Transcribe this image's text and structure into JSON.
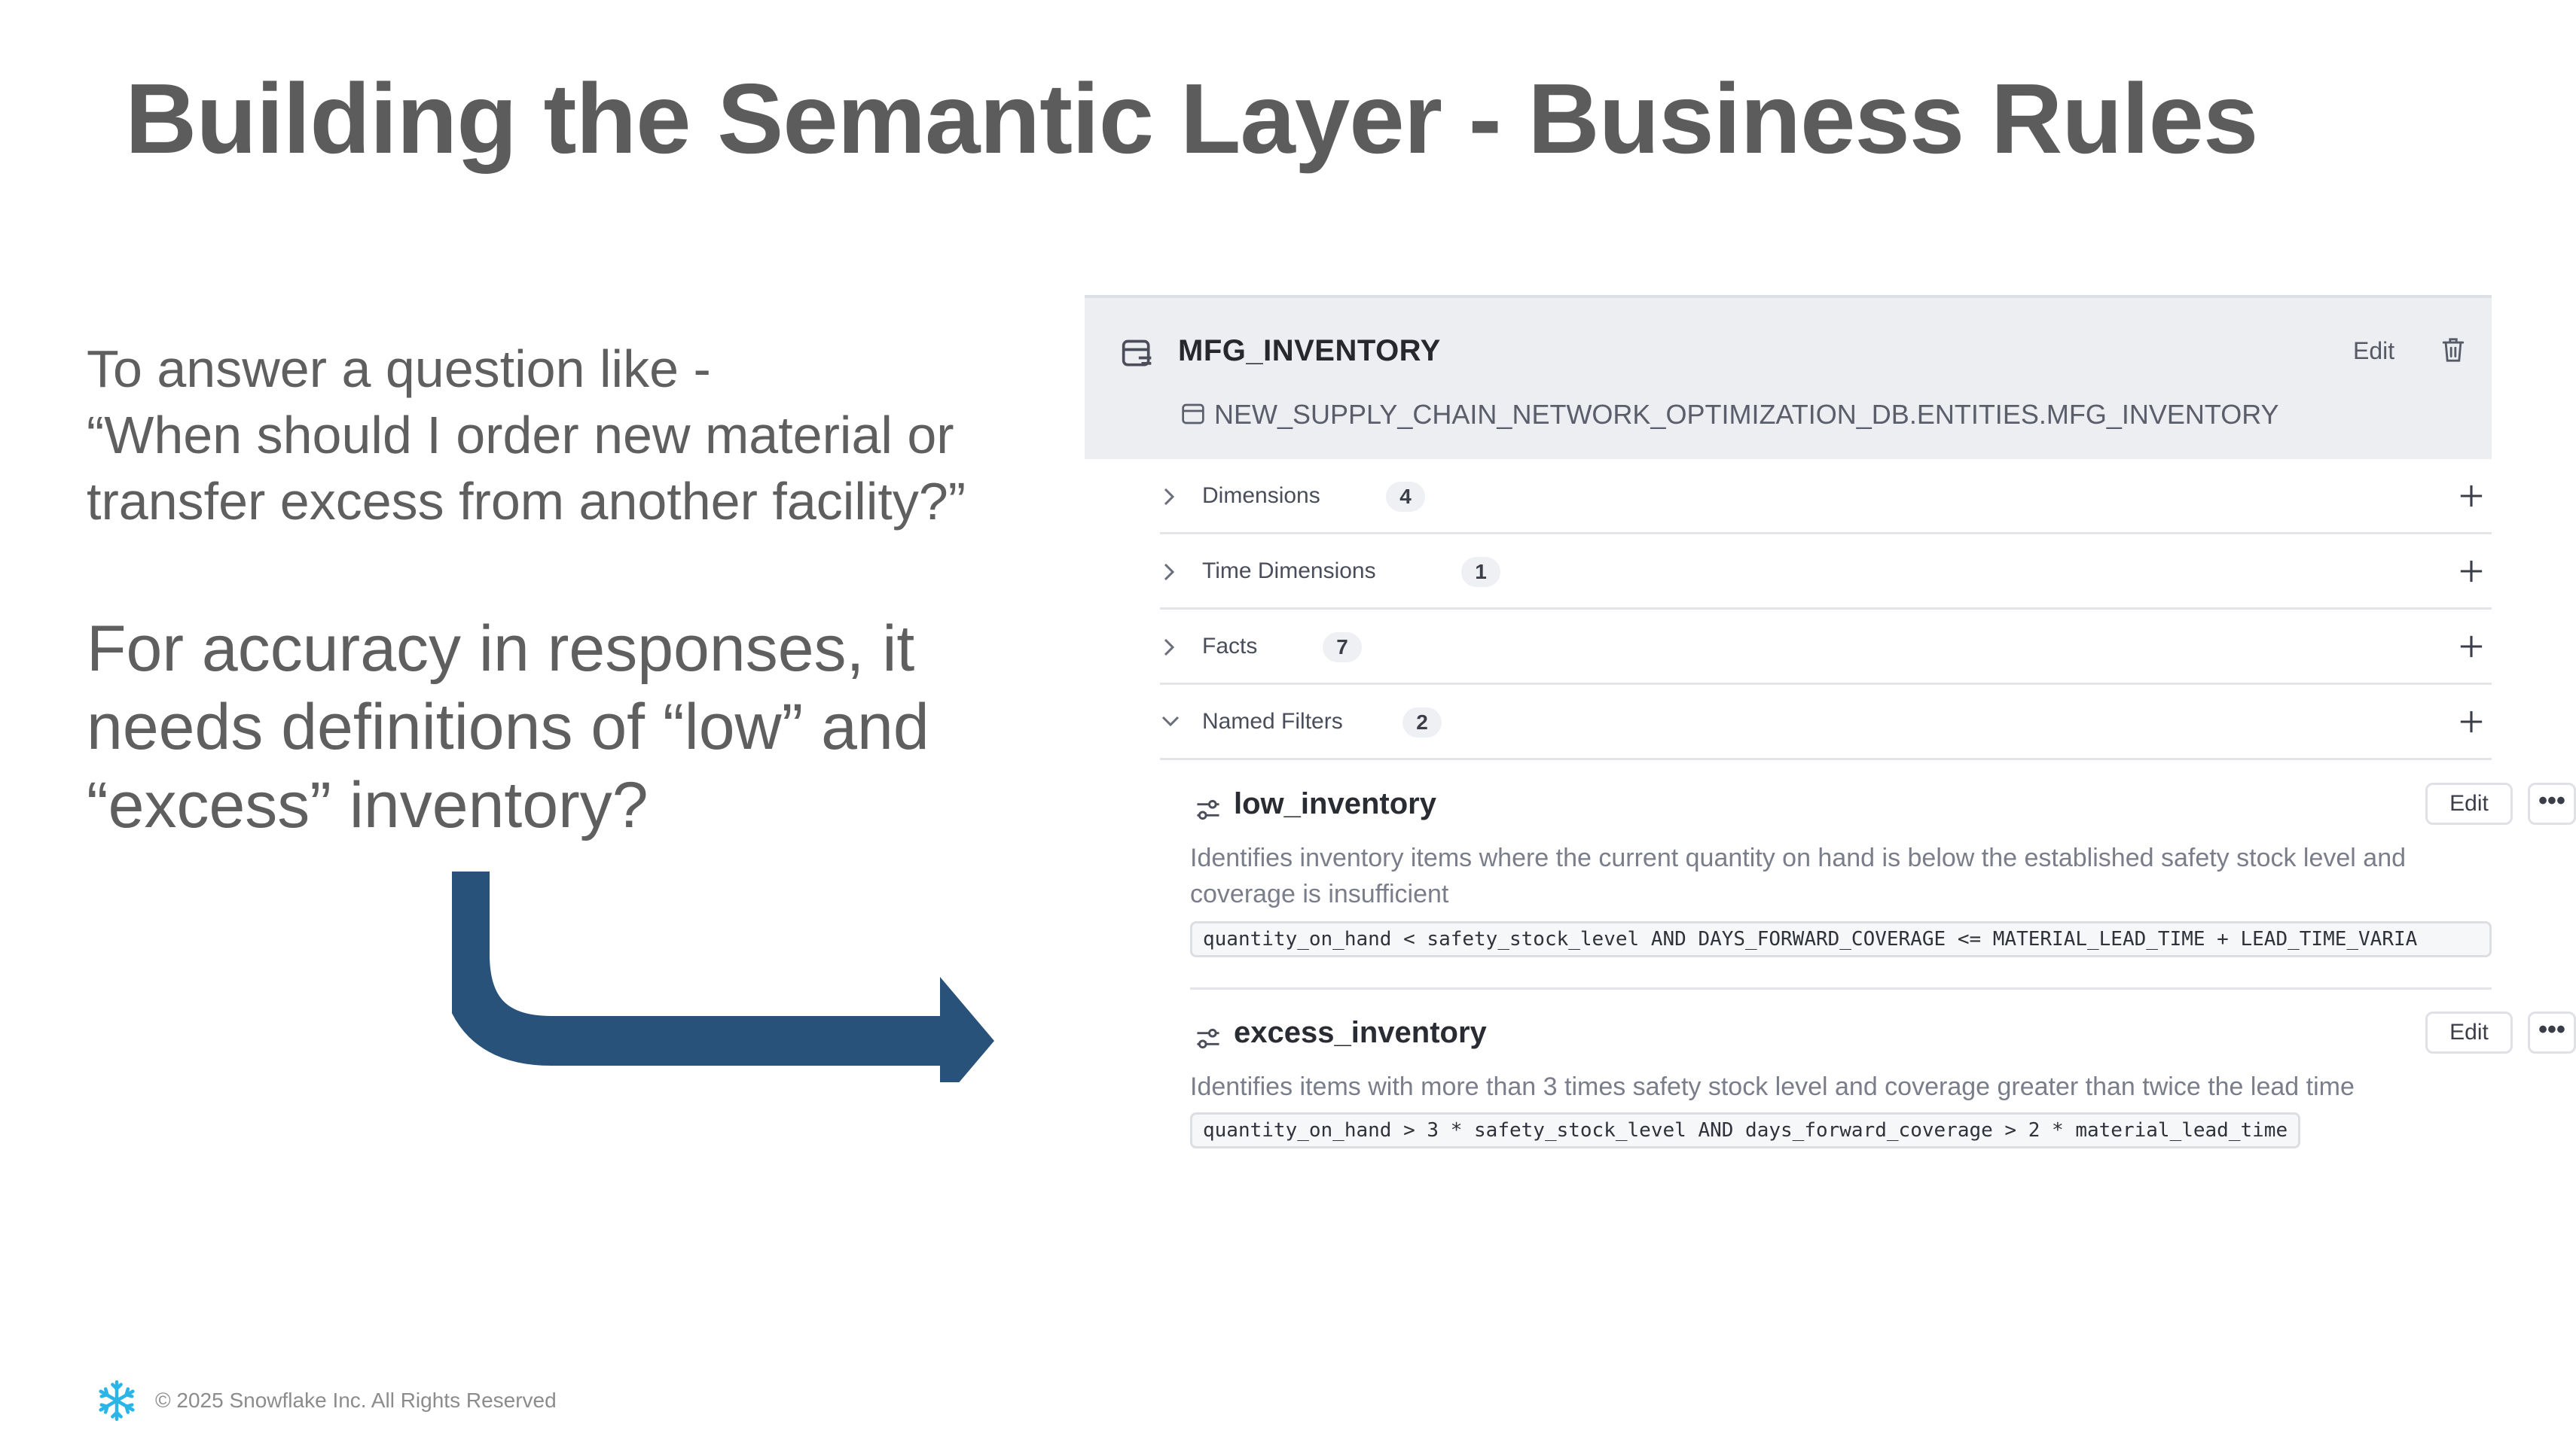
{
  "slide": {
    "title": "Building the Semantic Layer - Business Rules",
    "question_lines": [
      "To answer a question like -",
      "“When should I order new material or",
      "transfer excess from another facility?”"
    ],
    "note_lines": [
      "For accuracy in responses, it",
      "needs definitions of “low” and",
      "“excess” inventory?"
    ],
    "footer": "© 2025 Snowflake Inc. All Rights Reserved",
    "accent_color": "#28527a",
    "logo_color": "#29b5e8"
  },
  "entity": {
    "name": "MFG_INVENTORY",
    "path": "NEW_SUPPLY_CHAIN_NETWORK_OPTIMIZATION_DB.ENTITIES.MFG_INVENTORY",
    "edit_label": "Edit",
    "sections": [
      {
        "label": "Dimensions",
        "count": "4",
        "expanded": false
      },
      {
        "label": "Time Dimensions",
        "count": "1",
        "expanded": false
      },
      {
        "label": "Facts",
        "count": "7",
        "expanded": false
      },
      {
        "label": "Named Filters",
        "count": "2",
        "expanded": true
      }
    ],
    "filters": [
      {
        "name": "low_inventory",
        "edit_label": "Edit",
        "more_label": "•••",
        "description": "Identifies inventory items where the current quantity on hand is below the established safety stock level and coverage is insufficient",
        "expression": "quantity_on_hand < safety_stock_level AND DAYS_FORWARD_COVERAGE <= MATERIAL_LEAD_TIME + LEAD_TIME_VARIA"
      },
      {
        "name": "excess_inventory",
        "edit_label": "Edit",
        "more_label": "•••",
        "description": "Identifies items with more than 3 times safety stock level and coverage greater than twice the lead time",
        "expression": "quantity_on_hand > 3 * safety_stock_level AND days_forward_coverage > 2 * material_lead_time"
      }
    ]
  }
}
